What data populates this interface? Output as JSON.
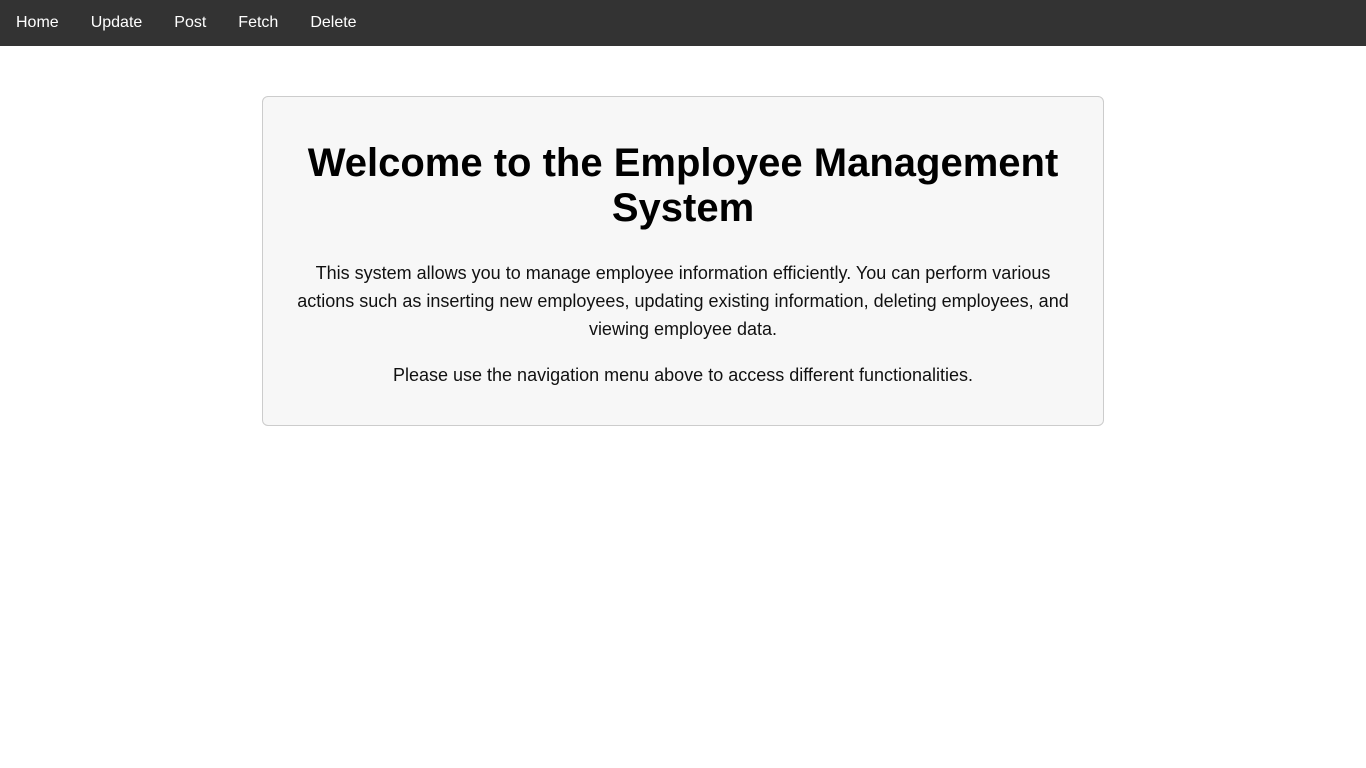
{
  "nav": {
    "items": [
      {
        "label": "Home"
      },
      {
        "label": "Update"
      },
      {
        "label": "Post"
      },
      {
        "label": "Fetch"
      },
      {
        "label": "Delete"
      }
    ]
  },
  "main": {
    "title": "Welcome to the Employee Management System",
    "paragraphs": [
      "This system allows you to manage employee information efficiently. You can perform various actions such as inserting new employees, updating existing information, deleting employees, and viewing employee data.",
      "Please use the navigation menu above to access different functionalities."
    ]
  },
  "colors": {
    "navbar_bg": "#333333",
    "nav_text": "#ffffff",
    "card_bg": "#f7f7f7",
    "card_border": "#cccccc",
    "title_text": "#000000"
  }
}
